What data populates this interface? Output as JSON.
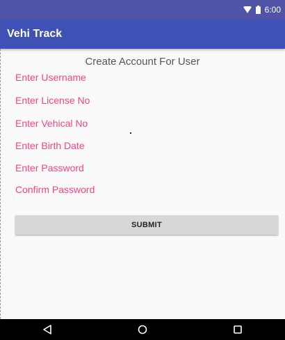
{
  "status_bar": {
    "time": "6:00",
    "icons": [
      "wifi-icon",
      "battery-icon"
    ]
  },
  "app_bar": {
    "title": "Vehi Track"
  },
  "form": {
    "title": "Create Account For User",
    "fields": {
      "username": "Enter Username",
      "license": "Enter License No",
      "vehicle": "Enter Vehical No",
      "birth_date": "Enter Birth Date",
      "password": "Enter Password",
      "confirm_password": "Confirm Password"
    },
    "submit_label": "SUBMIT"
  },
  "nav_bar": {
    "icons": [
      "back-icon",
      "home-icon",
      "recents-icon"
    ]
  },
  "colors": {
    "status_bar": "#5153a6",
    "app_bar": "#3f51b5",
    "hint_text": "#ff4081",
    "button": "#d8d8d8"
  }
}
